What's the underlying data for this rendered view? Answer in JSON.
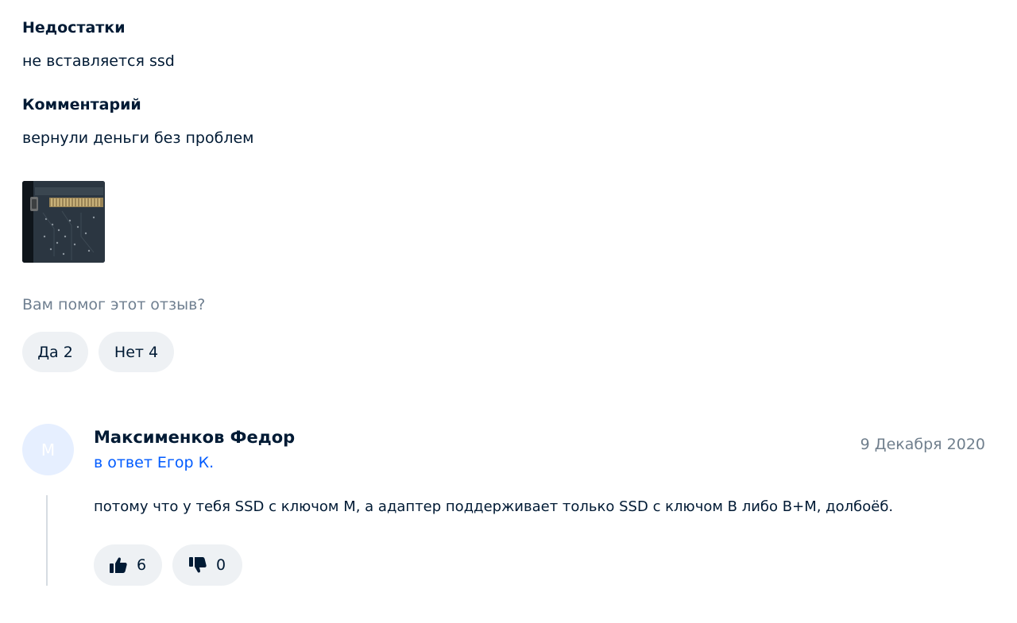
{
  "review": {
    "cons_title": "Недостатки",
    "cons_text": "не вставляется ssd",
    "comment_title": "Комментарий",
    "comment_text": "вернули деньги без проблем",
    "helpful_question": "Вам помог этот отзыв?",
    "yes_label": "Да 2",
    "no_label": "Нет 4"
  },
  "reply": {
    "avatar_letter": "М",
    "author": "Максименков Федор",
    "reply_to": "в ответ Егор К.",
    "date": "9 Декабря 2020",
    "text": "потому что у тебя SSD с ключом M, а адаптер поддерживает только SSD с ключом B либо B+M, долбоёб.",
    "likes": "6",
    "dislikes": "0"
  },
  "icons": {
    "like": "thumbs-up-icon",
    "dislike": "thumbs-down-icon"
  }
}
